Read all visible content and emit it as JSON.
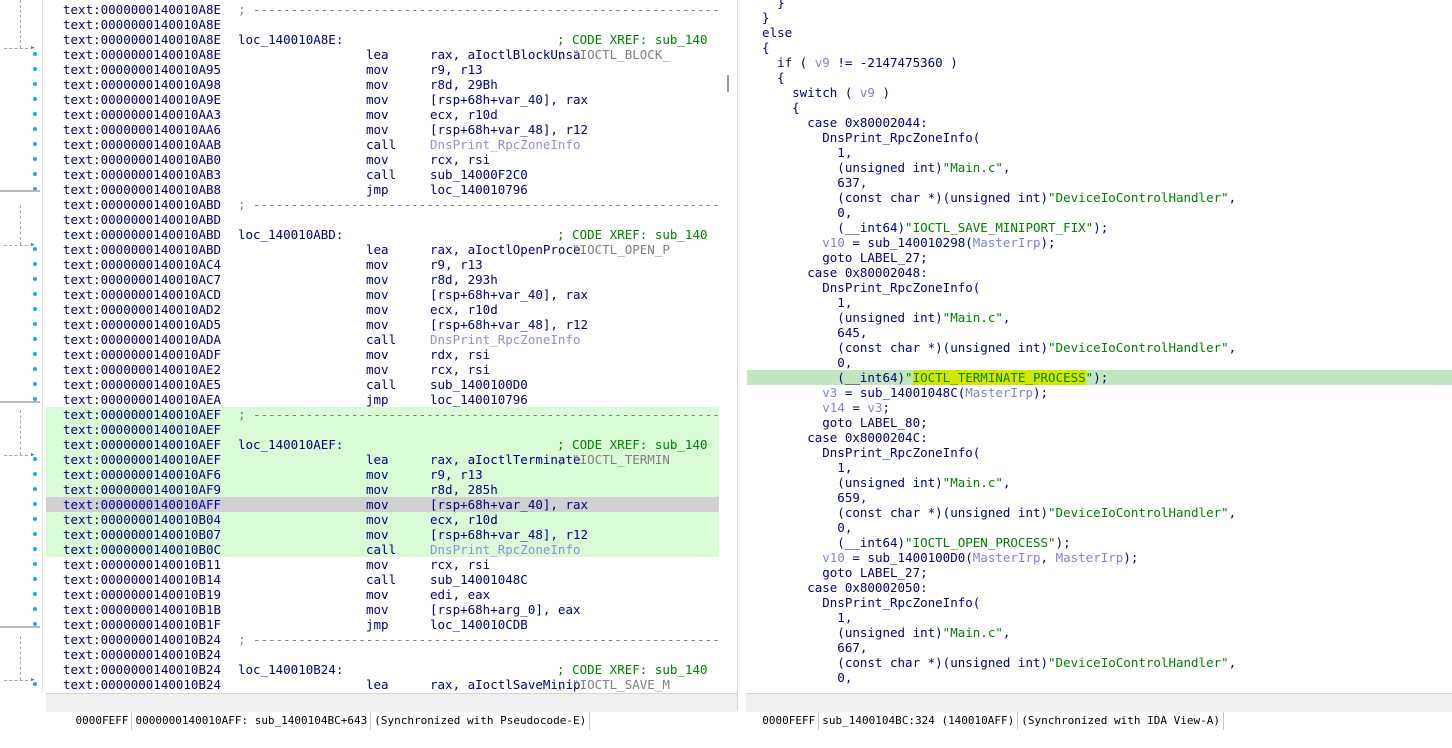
{
  "disassembly": {
    "lines": [
      {
        "addr": "text:0000000140010A8E",
        "sep": "; ---------------------------------------------------------------------------"
      },
      {
        "addr": "text:0000000140010A8E"
      },
      {
        "addr": "text:0000000140010A8E",
        "label": "loc_140010A8E:",
        "comment": "; CODE XREF: sub_140"
      },
      {
        "addr": "text:0000000140010A8E",
        "mnem": "lea",
        "ops": "rax, aIoctlBlockUnsa",
        "comment": "; \"IOCTL_BLOCK_"
      },
      {
        "addr": "text:0000000140010A95",
        "mnem": "mov",
        "ops": "r9, r13"
      },
      {
        "addr": "text:0000000140010A98",
        "mnem": "mov",
        "ops": "r8d, 29Bh"
      },
      {
        "addr": "text:0000000140010A9E",
        "mnem": "mov",
        "ops": "[rsp+68h+var_40], rax"
      },
      {
        "addr": "text:0000000140010AA3",
        "mnem": "mov",
        "ops": "ecx, r10d"
      },
      {
        "addr": "text:0000000140010AA6",
        "mnem": "mov",
        "ops": "[rsp+68h+var_48], r12"
      },
      {
        "addr": "text:0000000140010AAB",
        "mnem": "call",
        "ops": "DnsPrint_RpcZoneInfo",
        "grey": true
      },
      {
        "addr": "text:0000000140010AB0",
        "mnem": "mov",
        "ops": "rcx, rsi"
      },
      {
        "addr": "text:0000000140010AB3",
        "mnem": "call",
        "ops": "sub_14000F2C0"
      },
      {
        "addr": "text:0000000140010AB8",
        "mnem": "jmp",
        "ops": "loc_140010796"
      },
      {
        "addr": "text:0000000140010ABD",
        "sep": "; ---------------------------------------------------------------------------"
      },
      {
        "addr": "text:0000000140010ABD"
      },
      {
        "addr": "text:0000000140010ABD",
        "label": "loc_140010ABD:",
        "comment": "; CODE XREF: sub_140"
      },
      {
        "addr": "text:0000000140010ABD",
        "mnem": "lea",
        "ops": "rax, aIoctlOpenProce",
        "comment": "; \"IOCTL_OPEN_P"
      },
      {
        "addr": "text:0000000140010AC4",
        "mnem": "mov",
        "ops": "r9, r13"
      },
      {
        "addr": "text:0000000140010AC7",
        "mnem": "mov",
        "ops": "r8d, 293h"
      },
      {
        "addr": "text:0000000140010ACD",
        "mnem": "mov",
        "ops": "[rsp+68h+var_40], rax"
      },
      {
        "addr": "text:0000000140010AD2",
        "mnem": "mov",
        "ops": "ecx, r10d"
      },
      {
        "addr": "text:0000000140010AD5",
        "mnem": "mov",
        "ops": "[rsp+68h+var_48], r12"
      },
      {
        "addr": "text:0000000140010ADA",
        "mnem": "call",
        "ops": "DnsPrint_RpcZoneInfo",
        "grey": true
      },
      {
        "addr": "text:0000000140010ADF",
        "mnem": "mov",
        "ops": "rdx, rsi"
      },
      {
        "addr": "text:0000000140010AE2",
        "mnem": "mov",
        "ops": "rcx, rsi"
      },
      {
        "addr": "text:0000000140010AE5",
        "mnem": "call",
        "ops": "sub_1400100D0"
      },
      {
        "addr": "text:0000000140010AEA",
        "mnem": "jmp",
        "ops": "loc_140010796"
      },
      {
        "addr": "text:0000000140010AEF",
        "sep": "; ---------------------------------------------------------------------------",
        "hl": true
      },
      {
        "addr": "text:0000000140010AEF",
        "hl": true
      },
      {
        "addr": "text:0000000140010AEF",
        "label": "loc_140010AEF:",
        "comment": "; CODE XREF: sub_140",
        "hl": true
      },
      {
        "addr": "text:0000000140010AEF",
        "mnem": "lea",
        "ops": "rax, aIoctlTerminate",
        "comment": "; \"IOCTL_TERMIN",
        "hl": true
      },
      {
        "addr": "text:0000000140010AF6",
        "mnem": "mov",
        "ops": "r9, r13",
        "hl": true
      },
      {
        "addr": "text:0000000140010AF9",
        "mnem": "mov",
        "ops": "r8d, 285h",
        "hl": true
      },
      {
        "addr": "text:0000000140010AFF",
        "mnem": "mov",
        "ops": "[rsp+68h+var_40], rax",
        "cur": true
      },
      {
        "addr": "text:0000000140010B04",
        "mnem": "mov",
        "ops": "ecx, r10d",
        "hl": true
      },
      {
        "addr": "text:0000000140010B07",
        "mnem": "mov",
        "ops": "[rsp+68h+var_48], r12",
        "hl": true
      },
      {
        "addr": "text:0000000140010B0C",
        "mnem": "call",
        "ops": "DnsPrint_RpcZoneInfo",
        "grey": true,
        "hl": true
      },
      {
        "addr": "text:0000000140010B11",
        "mnem": "mov",
        "ops": "rcx, rsi"
      },
      {
        "addr": "text:0000000140010B14",
        "mnem": "call",
        "ops": "sub_14001048C"
      },
      {
        "addr": "text:0000000140010B19",
        "mnem": "mov",
        "ops": "edi, eax"
      },
      {
        "addr": "text:0000000140010B1B",
        "mnem": "mov",
        "ops": "[rsp+68h+arg_0], eax"
      },
      {
        "addr": "text:0000000140010B1F",
        "mnem": "jmp",
        "ops": "loc_140010CDB"
      },
      {
        "addr": "text:0000000140010B24",
        "sep": "; ---------------------------------------------------------------------------"
      },
      {
        "addr": "text:0000000140010B24"
      },
      {
        "addr": "text:0000000140010B24",
        "label": "loc_140010B24:",
        "comment": "; CODE XREF: sub_140"
      },
      {
        "addr": "text:0000000140010B24",
        "mnem": "lea",
        "ops": "rax, aIoctlSaveMinip",
        "comment": "; \"IOCTL_SAVE_M"
      }
    ]
  },
  "pseudocode": {
    "lines": [
      [
        {
          "t": "    }"
        }
      ],
      [
        {
          "t": "  }"
        }
      ],
      [
        {
          "t": "  else"
        }
      ],
      [
        {
          "t": "  {"
        }
      ],
      [
        {
          "t": "    if ( "
        },
        {
          "t": "v9",
          "c": "var"
        },
        {
          "t": " != -2147475360 )"
        }
      ],
      [
        {
          "t": "    {"
        }
      ],
      [
        {
          "t": "      switch ( "
        },
        {
          "t": "v9",
          "c": "var"
        },
        {
          "t": " )"
        }
      ],
      [
        {
          "t": "      {"
        }
      ],
      [
        {
          "t": "        case 0x80002044:"
        }
      ],
      [
        {
          "t": "          DnsPrint_RpcZoneInfo("
        }
      ],
      [
        {
          "t": "            1,"
        }
      ],
      [
        {
          "t": "            (unsigned int)"
        },
        {
          "t": "\"Main.c\"",
          "c": "str"
        },
        {
          "t": ","
        }
      ],
      [
        {
          "t": "            637,"
        }
      ],
      [
        {
          "t": "            (const char *)(unsigned int)"
        },
        {
          "t": "\"DeviceIoControlHandler\"",
          "c": "str"
        },
        {
          "t": ","
        }
      ],
      [
        {
          "t": "            0,"
        }
      ],
      [
        {
          "t": "            (__int64)"
        },
        {
          "t": "\"IOCTL_SAVE_MINIPORT_FIX\"",
          "c": "str"
        },
        {
          "t": ");"
        }
      ],
      [
        {
          "t": "          "
        },
        {
          "t": "v10",
          "c": "var"
        },
        {
          "t": " = sub_140010298("
        },
        {
          "t": "MasterIrp",
          "c": "var"
        },
        {
          "t": ");"
        }
      ],
      [
        {
          "t": "          goto LABEL_27;"
        }
      ],
      [
        {
          "t": "        case 0x80002048:"
        }
      ],
      [
        {
          "t": "          DnsPrint_RpcZoneInfo("
        }
      ],
      [
        {
          "t": "            1,"
        }
      ],
      [
        {
          "t": "            (unsigned int)"
        },
        {
          "t": "\"Main.c\"",
          "c": "str"
        },
        {
          "t": ","
        }
      ],
      [
        {
          "t": "            645,"
        }
      ],
      [
        {
          "t": "            (const char *)(unsigned int)"
        },
        {
          "t": "\"DeviceIoControlHandler\"",
          "c": "str"
        },
        {
          "t": ","
        }
      ],
      [
        {
          "t": "            0,"
        }
      ],
      [
        {
          "t": "            (__int64)"
        },
        {
          "t": "\"",
          "c": "str"
        },
        {
          "t": "IOCTL_TERMINATE_PROCESS",
          "c": "strhl"
        },
        {
          "t": "\"",
          "c": "str"
        },
        {
          "t": ");"
        }
      ],
      [
        {
          "t": "          "
        },
        {
          "t": "v3",
          "c": "var"
        },
        {
          "t": " = sub_14001048C("
        },
        {
          "t": "MasterIrp",
          "c": "var"
        },
        {
          "t": ");"
        }
      ],
      [
        {
          "t": "          "
        },
        {
          "t": "v14",
          "c": "var"
        },
        {
          "t": " = "
        },
        {
          "t": "v3",
          "c": "var"
        },
        {
          "t": ";"
        }
      ],
      [
        {
          "t": "          goto LABEL_80;"
        }
      ],
      [
        {
          "t": "        case 0x8000204C:"
        }
      ],
      [
        {
          "t": "          DnsPrint_RpcZoneInfo("
        }
      ],
      [
        {
          "t": "            1,"
        }
      ],
      [
        {
          "t": "            (unsigned int)"
        },
        {
          "t": "\"Main.c\"",
          "c": "str"
        },
        {
          "t": ","
        }
      ],
      [
        {
          "t": "            659,"
        }
      ],
      [
        {
          "t": "            (const char *)(unsigned int)"
        },
        {
          "t": "\"DeviceIoControlHandler\"",
          "c": "str"
        },
        {
          "t": ","
        }
      ],
      [
        {
          "t": "            0,"
        }
      ],
      [
        {
          "t": "            (__int64)"
        },
        {
          "t": "\"IOCTL_OPEN_PROCESS\"",
          "c": "str"
        },
        {
          "t": ");"
        }
      ],
      [
        {
          "t": "          "
        },
        {
          "t": "v10",
          "c": "var"
        },
        {
          "t": " = sub_1400100D0("
        },
        {
          "t": "MasterIrp",
          "c": "var"
        },
        {
          "t": ", "
        },
        {
          "t": "MasterIrp",
          "c": "var"
        },
        {
          "t": ");"
        }
      ],
      [
        {
          "t": "          goto LABEL_27;"
        }
      ],
      [
        {
          "t": "        case 0x80002050:"
        }
      ],
      [
        {
          "t": "          DnsPrint_RpcZoneInfo("
        }
      ],
      [
        {
          "t": "            1,"
        }
      ],
      [
        {
          "t": "            (unsigned int)"
        },
        {
          "t": "\"Main.c\"",
          "c": "str"
        },
        {
          "t": ","
        }
      ],
      [
        {
          "t": "            667,"
        }
      ],
      [
        {
          "t": "            (const char *)(unsigned int)"
        },
        {
          "t": "\"DeviceIoControlHandler\"",
          "c": "str"
        },
        {
          "t": ","
        }
      ],
      [
        {
          "t": "            0,"
        }
      ]
    ],
    "highlighted_line_index": 25
  },
  "status_left": {
    "offset": "0000FEFF",
    "address": "0000000140010AFF: sub_1400104BC+643",
    "sync": "(Synchronized with Pseudocode-E)"
  },
  "status_right": {
    "offset": "0000FEFF",
    "address": "sub_1400104BC:324 (140010AFF)",
    "sync": "(Synchronized with IDA View-A)"
  },
  "colors": {
    "highlight_green": "#d9fcd6",
    "current_line": "#d0d0d0",
    "search_highlight": "#d4e600",
    "string_green": "#008000",
    "variable_blue": "#8080e0",
    "text_navy": "#000080"
  }
}
